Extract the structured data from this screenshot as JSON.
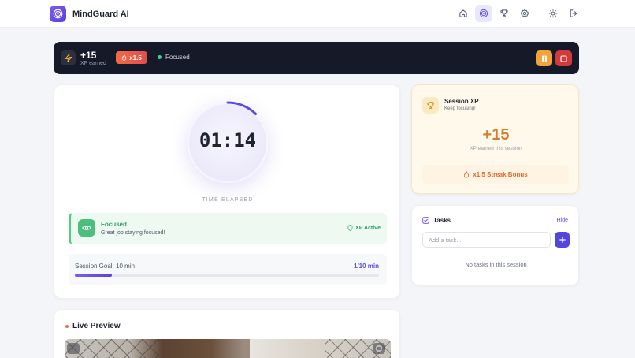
{
  "app": {
    "name": "MindGuard AI"
  },
  "nav": {
    "items": [
      {
        "name": "home-icon"
      },
      {
        "name": "target-icon",
        "active": true
      },
      {
        "name": "trophy-icon"
      },
      {
        "name": "gear-icon"
      },
      {
        "name": "sun-icon"
      },
      {
        "name": "logout-icon"
      }
    ]
  },
  "banner": {
    "xp_value": "+15",
    "xp_label": "XP earned",
    "multiplier": "x1.5",
    "status": "Focused",
    "status_color": "#34d399"
  },
  "timer": {
    "time": "01:14",
    "label": "TIME ELAPSED",
    "arc_progress": 0.123
  },
  "focus": {
    "title": "Focused",
    "subtitle": "Great job staying focused!",
    "badge": "XP Active"
  },
  "goal": {
    "label": "Session Goal: 10 min",
    "value": "1/10 min",
    "progress": 0.123
  },
  "session_xp": {
    "title": "Session XP",
    "subtitle": "Keep focusing!",
    "value": "+15",
    "note": "XP earned this session",
    "streak": "x1.5 Streak Bonus"
  },
  "tasks": {
    "title": "Tasks",
    "hide": "Hide",
    "placeholder": "Add a task...",
    "empty": "No tasks in this session"
  },
  "preview": {
    "title": "Live Preview"
  },
  "colors": {
    "accent": "#5b4ce0",
    "success": "#4cbf7c",
    "warning": "#f0a53a",
    "danger": "#d23b3b",
    "xp_orange": "#d9792b"
  }
}
